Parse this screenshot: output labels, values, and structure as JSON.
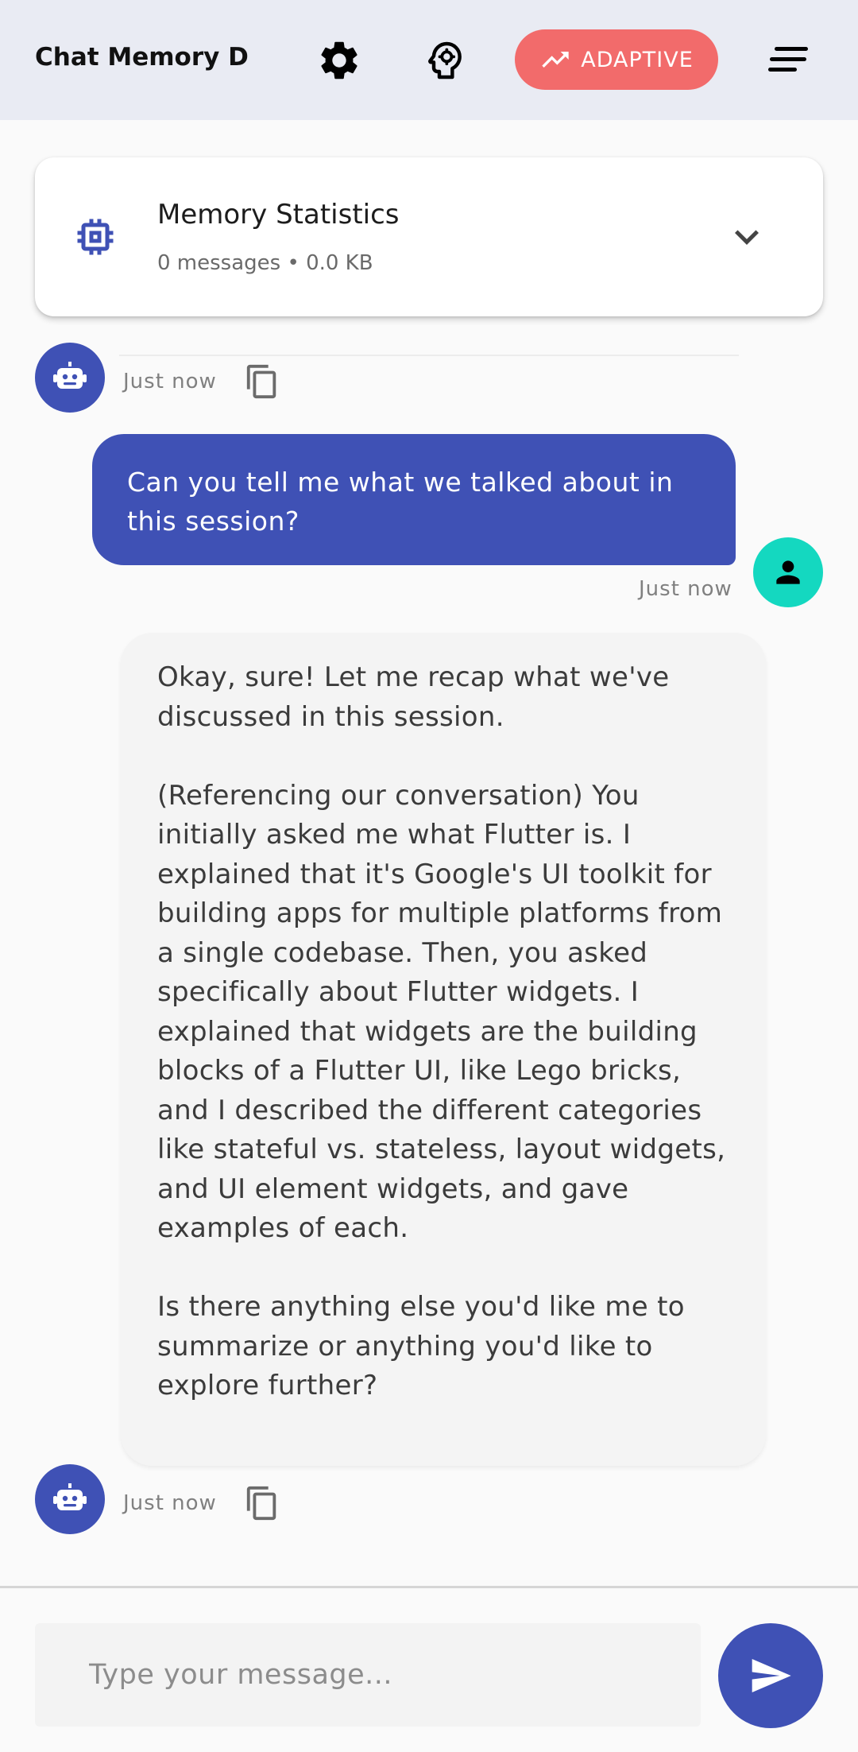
{
  "appbar": {
    "title": "Chat Memory D...",
    "settings_icon": "gear-icon",
    "brain_icon": "psychology-icon",
    "adaptive_label": "ADAPTIVE",
    "adaptive_icon": "trending-up-icon",
    "menu_icon": "sort-menu-icon",
    "background_color": "#e9ebf3",
    "adaptive_color": "#f26b6b"
  },
  "memory_stats": {
    "title": "Memory Statistics",
    "summary": "0 messages • 0.0 KB",
    "icon": "memory-chip-icon",
    "expand_icon": "chevron-down-icon"
  },
  "messages": [
    {
      "sender": "bot",
      "time": "Just now",
      "avatar_icon": "robot-icon",
      "copy_icon": "copy-icon"
    },
    {
      "sender": "user",
      "text": "Can you tell me what we talked about in this session?",
      "time": "Just now",
      "avatar_icon": "person-icon"
    },
    {
      "sender": "bot",
      "text": "Okay, sure! Let me recap what we've discussed in this session.\n\n(Referencing our conversation) You initially asked me what Flutter is. I explained that it's Google's UI toolkit for building apps for multiple platforms from a single codebase. Then, you asked specifically about Flutter widgets. I explained that widgets are the building blocks of a Flutter UI, like Lego bricks, and I described the different categories like stateful vs. stateless, layout widgets, and UI element widgets, and gave examples of each.\n\nIs there anything else you'd like me to summarize or anything you'd like to explore further?",
      "time": "Just now",
      "avatar_icon": "robot-icon",
      "copy_icon": "copy-icon"
    }
  ],
  "composer": {
    "placeholder": "Type your message...",
    "value": "",
    "send_icon": "send-icon"
  },
  "colors": {
    "primary": "#3f51b5",
    "user_avatar": "#14d8c0",
    "bot_bubble": "#f4f4f4"
  }
}
